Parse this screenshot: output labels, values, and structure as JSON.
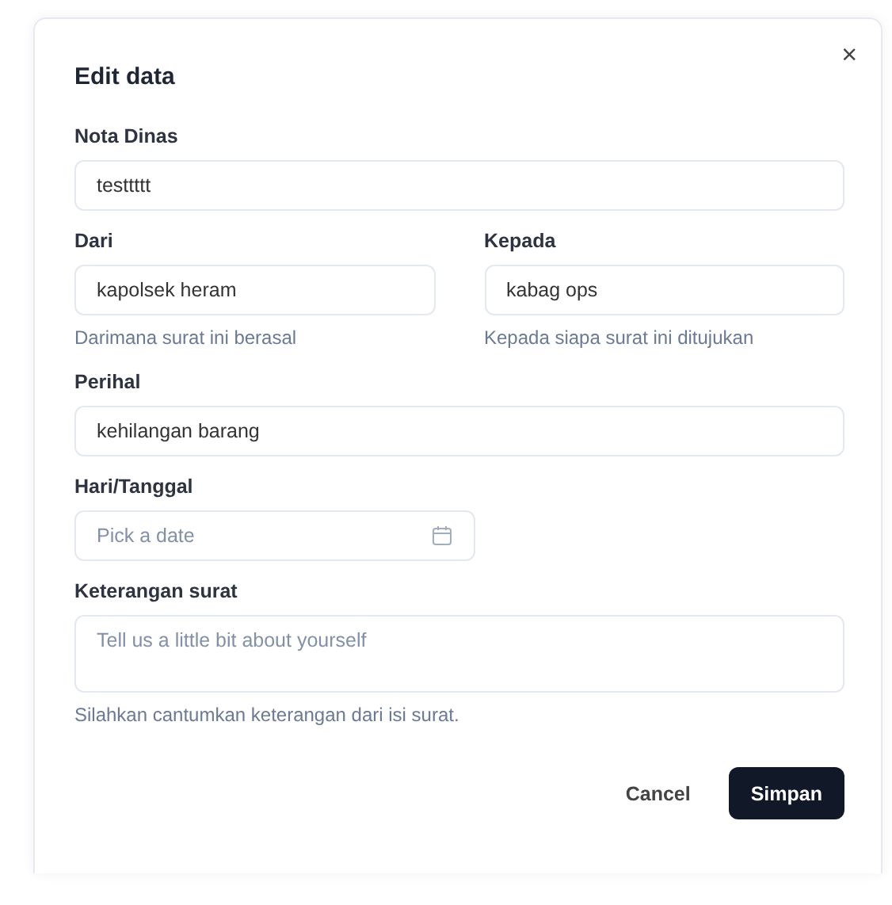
{
  "dialog": {
    "title": "Edit data",
    "close": "×",
    "fields": [
      {
        "kind": "text",
        "label": "Nota Dinas",
        "value": "testtttt"
      },
      {
        "kind": "pair",
        "fields": [
          {
            "kind": "text",
            "label": "Dari",
            "value": "kapolsek heram",
            "helper": "Darimana surat ini berasal"
          },
          {
            "kind": "text",
            "label": "Kepada",
            "value": "kabag ops",
            "helper": "Kepada siapa surat ini ditujukan"
          }
        ]
      },
      {
        "kind": "text",
        "label": "Perihal",
        "value": "kehilangan barang"
      },
      {
        "kind": "date",
        "label": "Hari/Tanggal",
        "placeholder": "Pick a date"
      },
      {
        "kind": "textarea",
        "label": "Keterangan surat",
        "placeholder": "Tell us a little bit about yourself",
        "helper": "Silahkan cantumkan keterangan dari isi surat."
      }
    ],
    "buttons": [
      {
        "kind": "ghost",
        "label": "Cancel"
      },
      {
        "kind": "primary",
        "label": "Simpan"
      }
    ]
  }
}
